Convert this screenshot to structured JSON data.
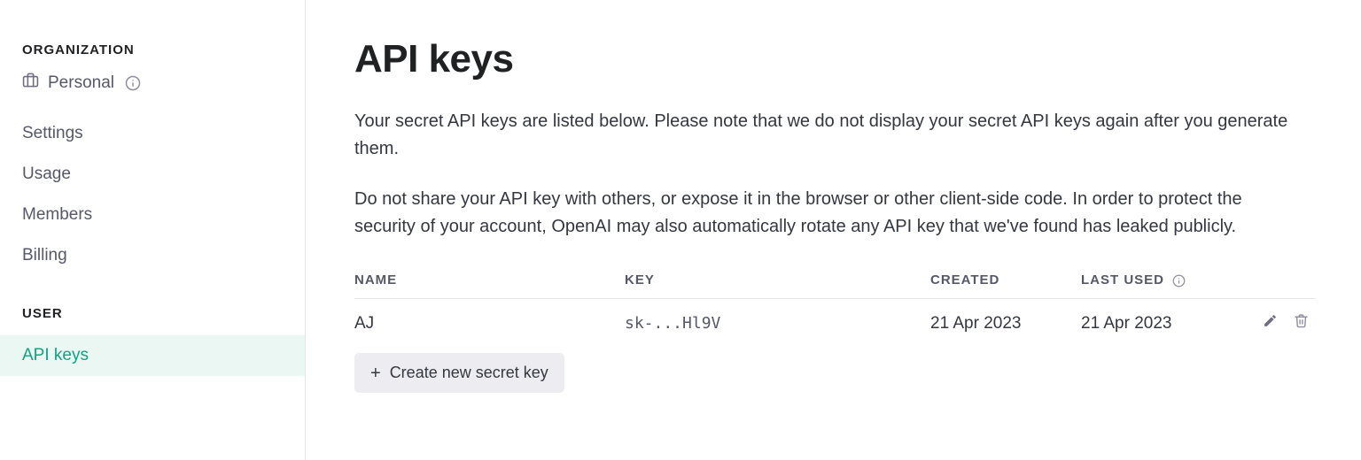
{
  "sidebar": {
    "org_heading": "ORGANIZATION",
    "org_name": "Personal",
    "org_items": [
      {
        "label": "Settings"
      },
      {
        "label": "Usage"
      },
      {
        "label": "Members"
      },
      {
        "label": "Billing"
      }
    ],
    "user_heading": "USER",
    "user_items": [
      {
        "label": "API keys",
        "active": true
      }
    ]
  },
  "page": {
    "title": "API keys",
    "desc1": "Your secret API keys are listed below. Please note that we do not display your secret API keys again after you generate them.",
    "desc2": "Do not share your API key with others, or expose it in the browser or other client-side code. In order to protect the security of your account, OpenAI may also automatically rotate any API key that we've found has leaked publicly."
  },
  "table": {
    "headers": {
      "name": "NAME",
      "key": "KEY",
      "created": "CREATED",
      "last_used": "LAST USED"
    },
    "rows": [
      {
        "name": "AJ",
        "key": "sk-...Hl9V",
        "created": "21 Apr 2023",
        "last_used": "21 Apr 2023"
      }
    ]
  },
  "actions": {
    "create_label": "Create new secret key"
  }
}
